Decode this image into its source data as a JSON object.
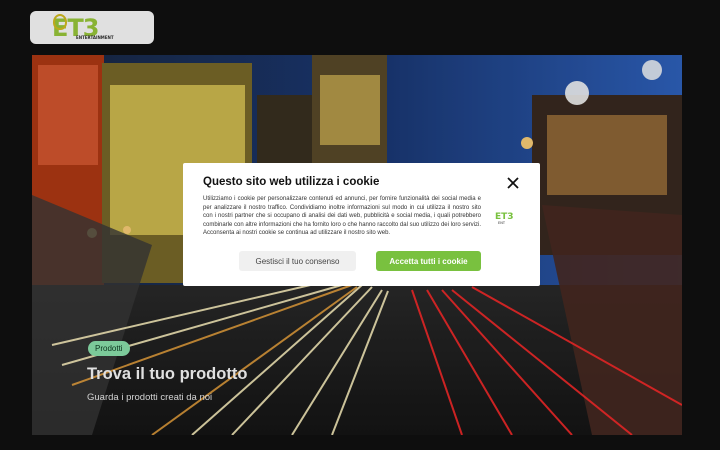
{
  "header": {
    "logo_text": "ET3",
    "logo_sub": "ENTERTAINMENT"
  },
  "hero": {
    "badge": "Prodotti",
    "title": "Trova il tuo prodotto",
    "subtitle": "Guarda i prodotti creati da noi"
  },
  "cookie_dialog": {
    "title": "Questo sito web utilizza i cookie",
    "body": "Utilizziamo i cookie per personalizzare contenuti ed annunci, per fornire funzionalità dei social media e per analizzare il nostro traffico. Condividiamo inoltre informazioni sul modo in cui utilizza il nostro sito con i nostri partner che si occupano di analisi dei dati web, pubblicità e social media, i quali potrebbero combinarle con altre informazioni che ha fornito loro o che hanno raccolto dal suo utilizzo dei loro servizi. Acconsenta ai nostri cookie se continua ad utilizzare il nostro sito web.",
    "manage_label": "Gestisci il tuo consenso",
    "accept_label": "Accetta tutti i cookie",
    "logo_text": "ET3"
  },
  "colors": {
    "accent_green": "#79c13f",
    "badge_green": "#8ee6b0",
    "page_bg": "#111111"
  },
  "icons": {
    "close": "close-icon",
    "bulb": "lightbulb-icon"
  }
}
